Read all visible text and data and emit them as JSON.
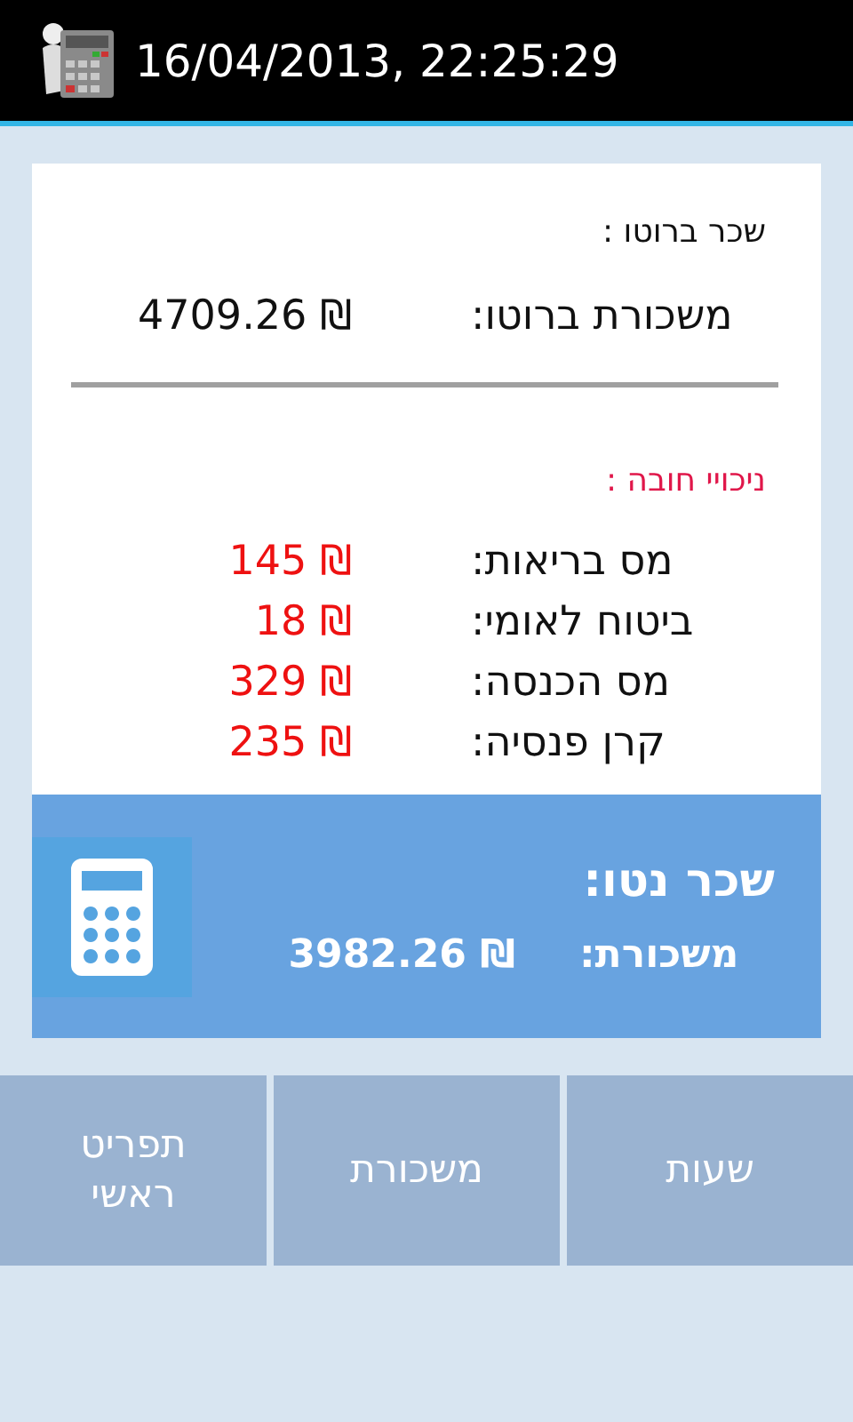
{
  "title_bar": {
    "datetime": "16/04/2013, 22:25:29"
  },
  "gross": {
    "heading": "שכר ברוטו :",
    "rows": [
      {
        "label": "משכורת ברוטו:",
        "value": "4709.26 ₪"
      }
    ]
  },
  "deductions": {
    "heading": "ניכויי חובה :",
    "rows": [
      {
        "label": "מס בריאות:",
        "value": "145 ₪"
      },
      {
        "label": "ביטוח לאומי:",
        "value": "18 ₪"
      },
      {
        "label": "מס הכנסה:",
        "value": "329 ₪"
      },
      {
        "label": "קרן פנסיה:",
        "value": "235 ₪"
      }
    ]
  },
  "net": {
    "heading": "שכר נטו:",
    "label": "משכורת:",
    "value": "3982.26 ₪"
  },
  "nav_buttons": [
    "שעות",
    "משכורת",
    "תפריט\nראשי"
  ]
}
